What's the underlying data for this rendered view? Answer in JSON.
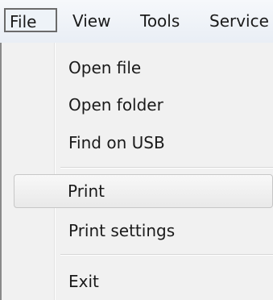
{
  "menubar": {
    "items": [
      {
        "label": "File",
        "active": true
      },
      {
        "label": "View"
      },
      {
        "label": "Tools"
      },
      {
        "label": "Service"
      }
    ]
  },
  "file_menu": {
    "items": [
      {
        "label": "Open file"
      },
      {
        "label": "Open folder"
      },
      {
        "label": "Find on USB"
      },
      {
        "label": "Print",
        "highlighted": true
      },
      {
        "label": "Print settings"
      },
      {
        "label": "Exit"
      }
    ]
  }
}
